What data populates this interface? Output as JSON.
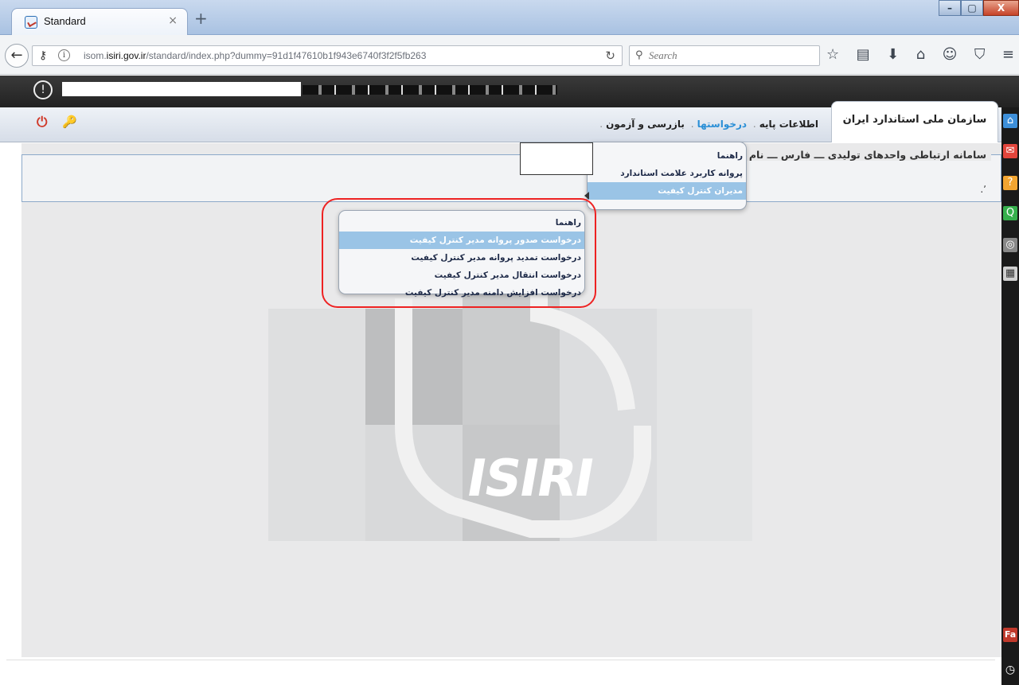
{
  "browser": {
    "tab_title": "Standard",
    "tab_close": "×",
    "new_tab": "+",
    "window_controls": [
      "–",
      "▢",
      "X"
    ],
    "url_prefix": "isom.",
    "url_domain": "isiri.gov.ir",
    "url_path": "/standard/index.php?dummy=91d1f47610b1f943e6740f3f2f5fb263",
    "search_placeholder": "Search",
    "toolbar_icons": [
      "star-icon",
      "reading-list-icon",
      "download-icon",
      "home-icon",
      "smiley-icon",
      "pocket-icon",
      "menu-icon"
    ],
    "toolbar_glyphs": [
      "☆",
      "▤",
      "⬇",
      "⌂",
      "☺",
      "⛉",
      "≡"
    ]
  },
  "site": {
    "brand": "سازمان ملی استاندارد ایران",
    "nav": [
      {
        "label": "اطلاعات پایه",
        "active": false
      },
      {
        "label": "درخواستها",
        "active": true
      },
      {
        "label": "بازرسی و آزمون",
        "active": false
      }
    ],
    "separator": ".",
    "system_title": "سامانه ارتباطی واحدهای تولیدی ـــ فارس ـــ نام وا",
    "dot_text": ".٬"
  },
  "menu1": {
    "items": [
      {
        "label": "راهنما",
        "highlighted": false
      },
      {
        "label": "پروانه کاربرد علامت استاندارد",
        "highlighted": false
      },
      {
        "label": "مدیران کنترل کیفیت",
        "highlighted": true
      }
    ]
  },
  "menu2": {
    "items": [
      {
        "label": "راهنما",
        "highlighted": false
      },
      {
        "label": "درخواست صدور پروانه مدیر کنترل کیفیت",
        "highlighted": true
      },
      {
        "label": "درخواست تمدید پروانه مدیر کنترل کیفیت",
        "highlighted": false
      },
      {
        "label": "درخواست انتقال مدیر کنترل کیفیت",
        "highlighted": false
      },
      {
        "label": "درخواست افزایش دامنه مدیر کنترل کیفیت",
        "highlighted": false
      }
    ]
  },
  "watermark": {
    "logo_text": "ISIRI"
  },
  "sidebar": {
    "labels": [
      "Fa"
    ],
    "colors": {
      "home": "#3d8fd9",
      "mail": "#e2453c",
      "help": "#f2a531",
      "search": "#36b04c",
      "support": "#888888",
      "calendar": "#cfcfcf",
      "fa": "#c0392b"
    }
  }
}
